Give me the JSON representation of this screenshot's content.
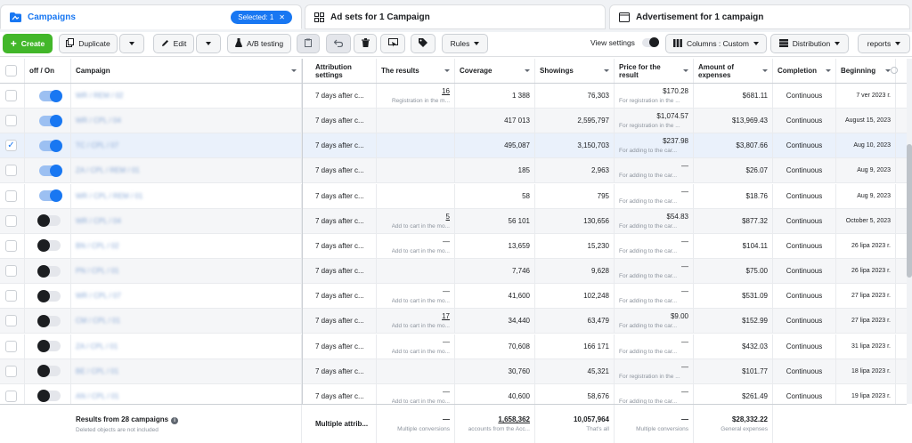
{
  "tabs": {
    "campaigns": "Campaigns",
    "selected": "Selected: 1",
    "adsets": "Ad sets for 1 Campaign",
    "ads": "Advertisement for 1 campaign"
  },
  "toolbar": {
    "create": "Create",
    "duplicate": "Duplicate",
    "edit": "Edit",
    "ab": "A/B testing",
    "rules": "Rules",
    "view_settings": "View settings",
    "columns": "Columns : Custom",
    "distribution": "Distribution",
    "reports": "reports"
  },
  "headers": {
    "onoff": "off / On",
    "campaign": "Campaign",
    "attribution": "Attribution settings",
    "results": "The results",
    "coverage": "Coverage",
    "showings": "Showings",
    "price": "Price for the result",
    "amount": "Amount of expenses",
    "completion": "Completion",
    "beginning": "Beginning"
  },
  "rows": [
    {
      "on": true,
      "checked": false,
      "name": "WR / REM / 02",
      "attr": "7 days after c...",
      "res": "16",
      "res_sub": "Registration in the m...",
      "cov": "1 388",
      "show": "76,303",
      "price": "$170.28",
      "price_sub": "For registration in the ...",
      "amt": "$681.11",
      "comp": "Continuous",
      "beg": "7 ver 2023 г."
    },
    {
      "on": true,
      "checked": false,
      "name": "WR / CPL / 04",
      "attr": "7 days after c...",
      "res": "",
      "res_sub": "",
      "cov": "417 013",
      "show": "2,595,797",
      "price": "$1,074.57",
      "price_sub": "For registration in the ...",
      "amt": "$13,969.43",
      "comp": "Continuous",
      "beg": "August 15, 2023"
    },
    {
      "on": true,
      "checked": true,
      "name": "TC / CPL / 07",
      "attr": "7 days after c...",
      "res": "",
      "res_sub": "",
      "cov": "495,087",
      "show": "3,150,703",
      "price": "$237.98",
      "price_sub": "For adding to the car...",
      "amt": "$3,807.66",
      "comp": "Continuous",
      "beg": "Aug 10, 2023"
    },
    {
      "on": true,
      "checked": false,
      "name": "ZA / CPL / REM / 01",
      "attr": "7 days after c...",
      "res": "",
      "res_sub": "",
      "cov": "185",
      "show": "2,963",
      "price": "—",
      "price_sub": "For adding to the car...",
      "amt": "$26.07",
      "comp": "Continuous",
      "beg": "Aug 9, 2023"
    },
    {
      "on": true,
      "checked": false,
      "name": "WR / CPL / REM / 01",
      "attr": "7 days after c...",
      "res": "",
      "res_sub": "",
      "cov": "58",
      "show": "795",
      "price": "—",
      "price_sub": "For adding to the car...",
      "amt": "$18.76",
      "comp": "Continuous",
      "beg": "Aug 9, 2023"
    },
    {
      "on": false,
      "checked": false,
      "name": "WR / CPL / 04",
      "attr": "7 days after c...",
      "res": "5",
      "res_sub": "Add to cart in the mo...",
      "cov": "56 101",
      "show": "130,656",
      "price": "$54.83",
      "price_sub": "For adding to the car...",
      "amt": "$877.32",
      "comp": "Continuous",
      "beg": "October 5, 2023"
    },
    {
      "on": false,
      "checked": false,
      "name": "BN / CPL / 02",
      "attr": "7 days after c...",
      "res": "—",
      "res_sub": "Add to cart in the mo...",
      "cov": "13,659",
      "show": "15,230",
      "price": "—",
      "price_sub": "For adding to the car...",
      "amt": "$104.11",
      "comp": "Continuous",
      "beg": "26 lipa 2023 r."
    },
    {
      "on": false,
      "checked": false,
      "name": "PN / CPL / 01",
      "attr": "7 days after c...",
      "res": "",
      "res_sub": "",
      "cov": "7,746",
      "show": "9,628",
      "price": "—",
      "price_sub": "For adding to the car...",
      "amt": "$75.00",
      "comp": "Continuous",
      "beg": "26 lipa 2023 r."
    },
    {
      "on": false,
      "checked": false,
      "name": "WR / CPL / 07",
      "attr": "7 days after c...",
      "res": "—",
      "res_sub": "Add to cart in the mo...",
      "cov": "41,600",
      "show": "102,248",
      "price": "—",
      "price_sub": "For adding to the car...",
      "amt": "$531.09",
      "comp": "Continuous",
      "beg": "27 lipa 2023 r."
    },
    {
      "on": false,
      "checked": false,
      "name": "CM / CPL / 01",
      "attr": "7 days after c...",
      "res": "17",
      "res_sub": "Add to cart in the mo...",
      "cov": "34,440",
      "show": "63,479",
      "price": "$9.00",
      "price_sub": "For adding to the car...",
      "amt": "$152.99",
      "comp": "Continuous",
      "beg": "27 lipa 2023 r."
    },
    {
      "on": false,
      "checked": false,
      "name": "ZA / CPL / 01",
      "attr": "7 days after c...",
      "res": "—",
      "res_sub": "Add to cart in the mo...",
      "cov": "70,608",
      "show": "166 171",
      "price": "—",
      "price_sub": "For adding to the car...",
      "amt": "$432.03",
      "comp": "Continuous",
      "beg": "31 lipa 2023 r."
    },
    {
      "on": false,
      "checked": false,
      "name": "BE / CPL / 01",
      "attr": "7 days after c...",
      "res": "",
      "res_sub": "",
      "cov": "30,760",
      "show": "45,321",
      "price": "—",
      "price_sub": "For registration in the ...",
      "amt": "$101.77",
      "comp": "Continuous",
      "beg": "18 lipa 2023 r."
    },
    {
      "on": false,
      "checked": false,
      "name": "AN / CPL / 01",
      "attr": "7 days after c...",
      "res": "—",
      "res_sub": "Add to cart in the mo...",
      "cov": "40,600",
      "show": "58,676",
      "price": "—",
      "price_sub": "For adding to the car...",
      "amt": "$261.49",
      "comp": "Continuous",
      "beg": "19 lipa 2023 r."
    }
  ],
  "footer": {
    "results": "Results from 28 campaigns",
    "deleted": "Deleted objects are not included",
    "attr": "Multiple attrib...",
    "res": "—",
    "res_sub": "Multiple conversions",
    "cov": "1,658,362",
    "cov_sub": "accounts from the Acc...",
    "show": "10,057,964",
    "show_sub": "That's all",
    "price": "—",
    "price_sub": "Multiple conversions",
    "amt": "$28,332.22",
    "amt_sub": "General expenses"
  }
}
